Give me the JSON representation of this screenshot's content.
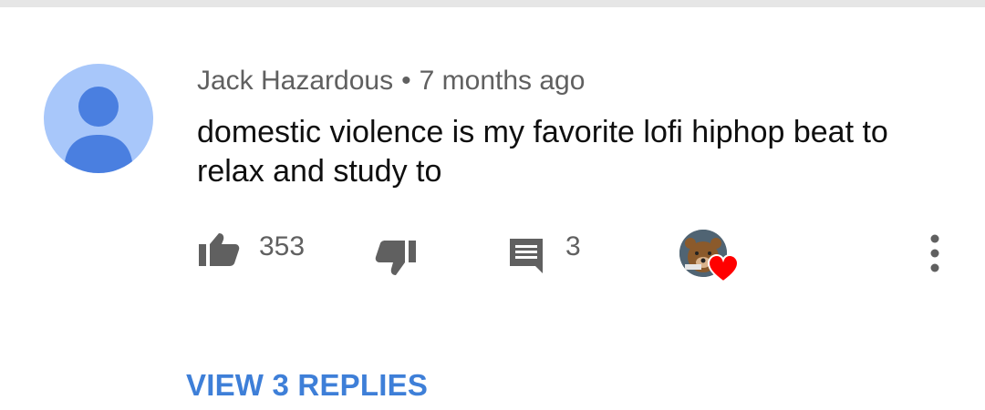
{
  "comment": {
    "author": "Jack Hazardous",
    "separator": "•",
    "timestamp": "7 months ago",
    "text": "domestic violence is my favorite lofi hiphop beat to relax and study to"
  },
  "actions": {
    "like_count": "353",
    "reply_count": "3"
  },
  "replies_link": "VIEW 3 REPLIES",
  "icons": {
    "like": "thumbs-up-icon",
    "dislike": "thumbs-down-icon",
    "reply": "comment-icon",
    "creator_heart": "heart-icon",
    "more": "more-vertical-icon"
  },
  "colors": {
    "avatar_bg": "#a8c7fa",
    "avatar_fg": "#4a7fe0",
    "link": "#3e7fd8",
    "heart": "#ff0000",
    "icon": "#606060"
  }
}
